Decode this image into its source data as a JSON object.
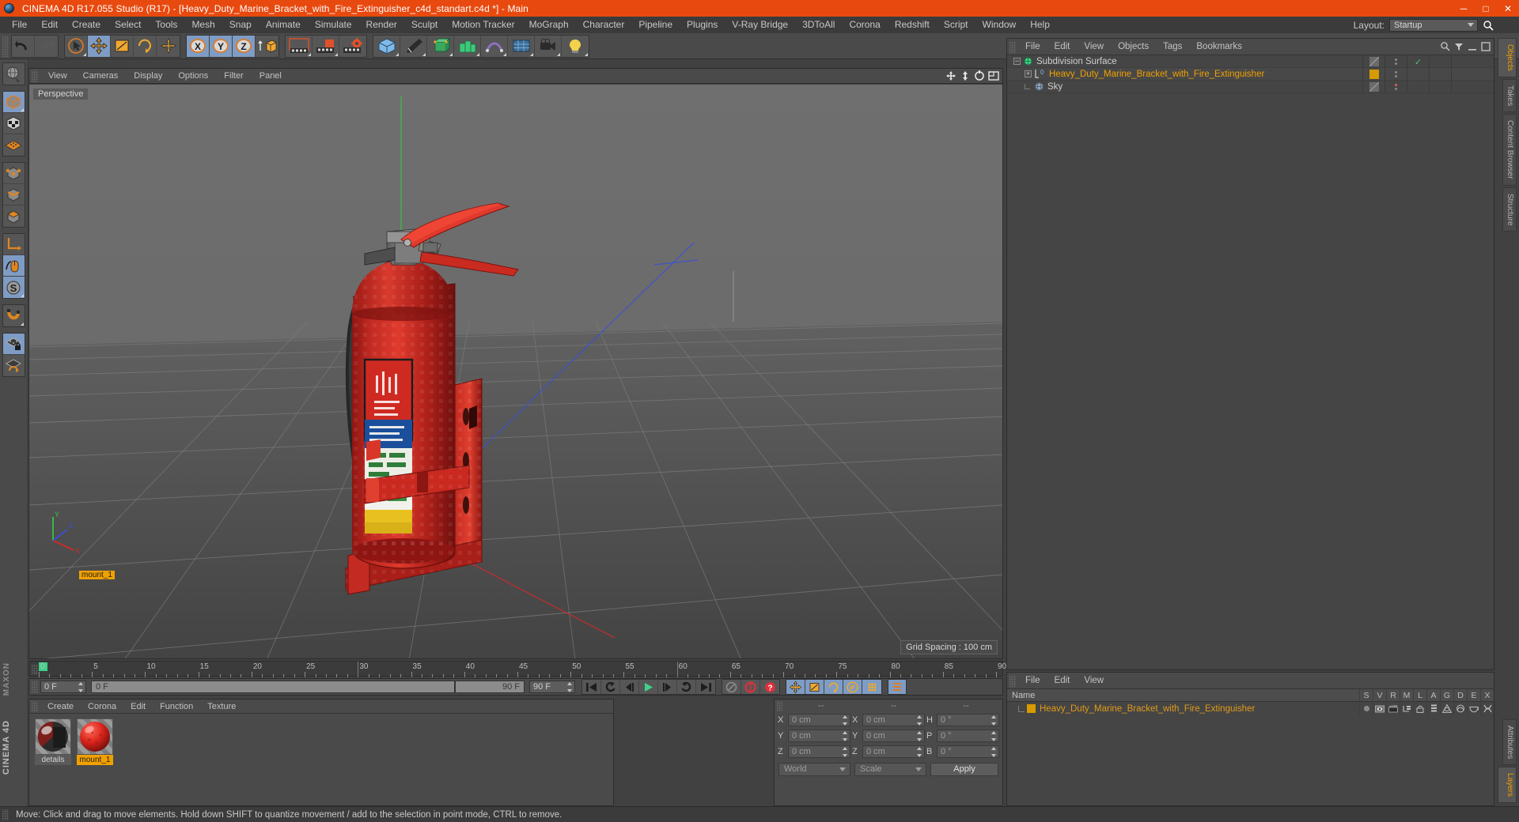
{
  "window": {
    "title": "CINEMA 4D R17.055 Studio (R17) - [Heavy_Duty_Marine_Bracket_with_Fire_Extinguisher_c4d_standart.c4d *] - Main",
    "minimize": "─",
    "maximize": "□",
    "close": "✕",
    "accent_color": "#e8490f",
    "background_color": "#414141"
  },
  "menubar": {
    "items": [
      "File",
      "Edit",
      "Create",
      "Select",
      "Tools",
      "Mesh",
      "Snap",
      "Animate",
      "Simulate",
      "Render",
      "Sculpt",
      "Motion Tracker",
      "MoGraph",
      "Character",
      "Pipeline",
      "Plugins",
      "V-Ray Bridge",
      "3DToAll",
      "Corona",
      "Redshift",
      "Script",
      "Window",
      "Help"
    ],
    "layout_label": "Layout:",
    "layout_value": "Startup",
    "search_icon": "search-icon"
  },
  "toolbar": {
    "groups": [
      {
        "name": "history",
        "buttons": [
          {
            "name": "undo-button",
            "icon": "undo-arrow-icon",
            "active": false
          },
          {
            "name": "redo-button",
            "icon": "redo-arrow-icon",
            "active": false,
            "disabled": true
          }
        ]
      },
      {
        "name": "transform-tools",
        "buttons": [
          {
            "name": "select-tool",
            "icon": "cursor-select-icon",
            "active": false
          },
          {
            "name": "move-tool",
            "icon": "move-arrows-icon",
            "active": true
          },
          {
            "name": "scale-tool",
            "icon": "scale-box-icon",
            "active": false
          },
          {
            "name": "rotate-tool",
            "icon": "rotate-circle-icon",
            "active": false
          },
          {
            "name": "offset-tool",
            "icon": "offset-cross-icon",
            "active": false
          }
        ]
      },
      {
        "name": "axis-locks",
        "buttons": [
          {
            "name": "lock-x-axis",
            "icon": "x-axis-icon",
            "active": true
          },
          {
            "name": "lock-y-axis",
            "icon": "y-axis-icon",
            "active": true
          },
          {
            "name": "lock-z-axis",
            "icon": "z-axis-icon",
            "active": true
          },
          {
            "name": "world-object-toggle",
            "icon": "world-coordinate-icon",
            "active": false
          }
        ]
      },
      {
        "name": "render-group",
        "buttons": [
          {
            "name": "render-view-button",
            "icon": "render-view-icon",
            "active": false
          },
          {
            "name": "render-to-picture-viewer-button",
            "icon": "render-picture-icon",
            "active": false
          },
          {
            "name": "render-settings-button",
            "icon": "render-settings-gear-icon",
            "active": false
          }
        ]
      },
      {
        "name": "create-group",
        "buttons": [
          {
            "name": "add-cube-button",
            "icon": "cube-primitive-icon",
            "active": false
          },
          {
            "name": "add-spline-button",
            "icon": "pen-spline-icon",
            "active": false
          },
          {
            "name": "add-generator-button",
            "icon": "nurbs-generator-icon",
            "active": false
          },
          {
            "name": "add-mograph-button",
            "icon": "mograph-cloner-icon",
            "active": false
          },
          {
            "name": "add-deformer-button",
            "icon": "deformer-icon",
            "active": false
          },
          {
            "name": "add-environment-button",
            "icon": "environment-floor-icon",
            "active": false
          },
          {
            "name": "add-camera-button",
            "icon": "camera-icon",
            "active": false
          },
          {
            "name": "add-light-button",
            "icon": "light-bulb-icon",
            "active": false
          }
        ]
      }
    ]
  },
  "left_palette": {
    "groups": [
      {
        "buttons": [
          {
            "name": "make-editable-button",
            "icon": "make-editable-globe-icon",
            "active": false
          }
        ]
      },
      {
        "buttons": [
          {
            "name": "model-mode-button",
            "icon": "model-cube-icon",
            "active": true
          },
          {
            "name": "texture-mode-button",
            "icon": "texture-checker-icon",
            "active": false
          },
          {
            "name": "workplane-mode-button",
            "icon": "workplane-grid-icon",
            "active": false
          }
        ]
      },
      {
        "buttons": [
          {
            "name": "points-mode-button",
            "icon": "points-cube-icon",
            "active": false
          },
          {
            "name": "edges-mode-button",
            "icon": "edges-cube-icon",
            "active": false
          },
          {
            "name": "polygons-mode-button",
            "icon": "polygons-cube-icon",
            "active": false
          }
        ]
      },
      {
        "buttons": [
          {
            "name": "object-axis-mode-button",
            "icon": "axis-arrow-icon",
            "active": false
          },
          {
            "name": "enable-axis-modification-button",
            "icon": "mouse-axis-icon",
            "active": true
          },
          {
            "name": "scale-mode-button",
            "icon": "scale-s-icon",
            "active": true
          }
        ]
      },
      {
        "buttons": [
          {
            "name": "magnet-tool-button",
            "icon": "magnet-icon",
            "active": false
          }
        ]
      },
      {
        "buttons": [
          {
            "name": "lock-workplane-button",
            "icon": "workplane-lock-icon",
            "active": true
          },
          {
            "name": "workplane-rotate-button",
            "icon": "workplane-rotate-icon",
            "active": false
          }
        ]
      }
    ],
    "brand_top": "MAXON",
    "brand_bottom": "CINEMA 4D"
  },
  "viewport": {
    "menu": [
      "View",
      "Cameras",
      "Display",
      "Options",
      "Filter",
      "Panel"
    ],
    "corner_icons": [
      "move-view-icon",
      "zoom-view-icon",
      "rotate-view-icon",
      "maximize-view-icon"
    ],
    "label": "Perspective",
    "grid_spacing": "Grid Spacing : 100 cm",
    "axis_gizmo": {
      "x_label": "X",
      "y_label": "Y",
      "z_label": "Z"
    },
    "scene_object_label": "mount_1"
  },
  "timeline": {
    "start_frame_value": "0 F",
    "end_frame_value": "90 F",
    "current_frame_value": "0 F",
    "preview_start": "0 F",
    "preview_end": "90 F",
    "ticks": [
      0,
      5,
      10,
      15,
      20,
      25,
      30,
      35,
      40,
      45,
      50,
      55,
      60,
      65,
      70,
      75,
      80,
      85,
      90
    ],
    "transport": [
      {
        "name": "go-to-start-button",
        "icon": "skip-start-icon"
      },
      {
        "name": "previous-keyframe-button",
        "icon": "prev-key-icon"
      },
      {
        "name": "step-back-button",
        "icon": "step-back-icon"
      },
      {
        "name": "play-button",
        "icon": "play-icon"
      },
      {
        "name": "step-forward-button",
        "icon": "step-forward-icon"
      },
      {
        "name": "next-keyframe-button",
        "icon": "next-key-icon"
      },
      {
        "name": "go-to-end-button",
        "icon": "skip-end-icon"
      }
    ],
    "record_tools": [
      {
        "name": "autokey-button",
        "icon": "autokey-icon"
      },
      {
        "name": "record-active-objects-button",
        "icon": "record-circle-icon"
      },
      {
        "name": "keyframe-selection-button",
        "icon": "keyframe-question-icon"
      }
    ],
    "key_toggles": [
      {
        "name": "position-key-toggle",
        "icon": "position-key-icon",
        "active": true
      },
      {
        "name": "scale-key-toggle",
        "icon": "scale-key-icon",
        "active": true
      },
      {
        "name": "rotation-key-toggle",
        "icon": "rotation-key-icon",
        "active": true
      },
      {
        "name": "parameter-key-toggle",
        "icon": "parameter-key-icon",
        "active": true
      },
      {
        "name": "point-level-animation-toggle",
        "icon": "pla-dots-icon",
        "active": true
      }
    ]
  },
  "material_manager": {
    "menu": [
      "Create",
      "Corona",
      "Edit",
      "Function",
      "Texture"
    ],
    "materials": [
      {
        "name": "details",
        "selected": false,
        "preview": "dark-glossy-sphere"
      },
      {
        "name": "mount_1",
        "selected": true,
        "preview": "red-glossy-sphere"
      }
    ]
  },
  "coordinate_manager": {
    "headers": [
      "--",
      "--",
      "--"
    ],
    "rows": [
      {
        "pos_axis": "X",
        "pos_value": "0 cm",
        "size_axis": "X",
        "size_value": "0 cm",
        "rot_axis": "H",
        "rot_value": "0 °"
      },
      {
        "pos_axis": "Y",
        "pos_value": "0 cm",
        "size_axis": "Y",
        "size_value": "0 cm",
        "rot_axis": "P",
        "rot_value": "0 °"
      },
      {
        "pos_axis": "Z",
        "pos_value": "0 cm",
        "size_axis": "Z",
        "size_value": "0 cm",
        "rot_axis": "B",
        "rot_value": "0 °"
      }
    ],
    "coordinate_system": "World",
    "size_mode": "Scale",
    "apply_label": "Apply"
  },
  "object_manager": {
    "menu": [
      "File",
      "Edit",
      "View",
      "Objects",
      "Tags",
      "Bookmarks"
    ],
    "header_icons": [
      "search-icon",
      "filter-icon",
      "minimize-panel-icon",
      "maximize-panel-icon"
    ],
    "items": [
      {
        "name": "Subdivision Surface",
        "icon": "subdivision-surface-icon",
        "depth": 0,
        "selected": false,
        "expander": "-",
        "tag_color": "#6b6b6b",
        "check": "✓",
        "check_color": "#4ec27a"
      },
      {
        "name": "Heavy_Duty_Marine_Bracket_with_Fire_Extinguisher",
        "icon": "null-object-icon",
        "depth": 1,
        "selected": true,
        "expander": "+",
        "tag_color": "#d79a00",
        "check": "",
        "check_color": ""
      },
      {
        "name": "Sky",
        "icon": "sky-object-icon",
        "depth": 1,
        "selected": false,
        "expander": "",
        "tag_color": "#6b6b6b",
        "check": "●",
        "check_color": "#e06060"
      }
    ]
  },
  "layer_manager": {
    "menu": [
      "File",
      "Edit",
      "View"
    ],
    "name_column": "Name",
    "columns": [
      "S",
      "V",
      "R",
      "M",
      "L",
      "A",
      "G",
      "D",
      "E",
      "X"
    ],
    "rows": [
      {
        "name": "Heavy_Duty_Marine_Bracket_with_Fire_Extinguisher",
        "color": "#d79a00",
        "switches": [
          "solo-dot-icon",
          "visible-eye-icon",
          "render-clapper-icon",
          "manager-icon",
          "lock-icon",
          "animation-icon",
          "generator-icon",
          "deformer-icon",
          "expression-icon",
          "xref-icon"
        ]
      }
    ]
  },
  "right_tabs": {
    "top": [
      {
        "label": "Objects",
        "active": true
      },
      {
        "label": "Takes",
        "active": false
      },
      {
        "label": "Content Browser",
        "active": false
      },
      {
        "label": "Structure",
        "active": false
      }
    ],
    "bottom": [
      {
        "label": "Attributes",
        "active": false
      },
      {
        "label": "Layers",
        "active": true
      }
    ]
  },
  "status_bar": {
    "text": "Move: Click and drag to move elements. Hold down SHIFT to quantize movement / add to the selection in point mode, CTRL to remove."
  }
}
